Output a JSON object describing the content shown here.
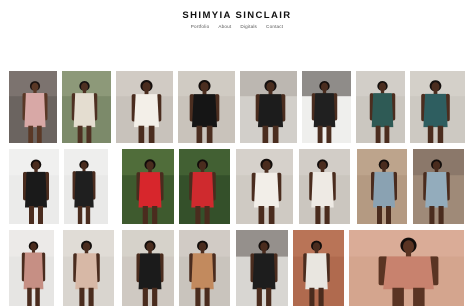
{
  "header": {
    "site_title": "SHIMYIA SINCLAIR",
    "nav": [
      "Portfolio",
      "About",
      "Digitals",
      "Contact"
    ]
  },
  "gallery": {
    "rows": [
      [
        {
          "name": "photo-pink-bra-dark-background",
          "colors": {
            "bg": "#6b6460",
            "top": "#8a807b",
            "skin": "#5a3826",
            "outfit": "#d8a8a6",
            "hair": "#1a1210"
          }
        },
        {
          "name": "photo-white-knit-green-background",
          "colors": {
            "bg": "#7c8a6a",
            "top": "#9aa585",
            "skin": "#4e3022",
            "outfit": "#e4ddd0",
            "hair": "#141010"
          }
        },
        {
          "name": "photo-afro-white-top-grey-background",
          "colors": {
            "bg": "#c8c2bb",
            "top": "#d8d3cc",
            "skin": "#4a2c1e",
            "outfit": "#f3efe8",
            "hair": "#140e0c"
          }
        },
        {
          "name": "photo-black-outfit-grey-background",
          "colors": {
            "bg": "#c9c3bb",
            "top": "#d6d1ca",
            "skin": "#4b2e20",
            "outfit": "#151515",
            "hair": "#120d0b"
          }
        },
        {
          "name": "photo-street-building-white-outfit",
          "colors": {
            "bg": "#d2cfca",
            "top": "#a9a49d",
            "skin": "#4a2d1f",
            "outfit": "#1c1c1c",
            "hair": "#141010"
          }
        },
        {
          "name": "photo-door-frame-black-outfit",
          "colors": {
            "bg": "#efefed",
            "top": "#3f3a36",
            "skin": "#4a2d1f",
            "outfit": "#202020",
            "hair": "#120d0b"
          }
        },
        {
          "name": "photo-green-dress-grey-background",
          "colors": {
            "bg": "#cbc7c0",
            "top": "#d8d4ce",
            "skin": "#4b2d1f",
            "outfit": "#2e5a55",
            "hair": "#140f0d"
          }
        },
        {
          "name": "photo-teal-slip-dress-grey-background",
          "colors": {
            "bg": "#cdc9c2",
            "top": "#dad6d0",
            "skin": "#4b2d1f",
            "outfit": "#2e5e60",
            "hair": "#140f0d"
          }
        }
      ],
      [
        {
          "name": "photo-crouching-white-wall",
          "colors": {
            "bg": "#ebebea",
            "top": "#f4f4f3",
            "skin": "#4a2c1e",
            "outfit": "#1a1a1a",
            "hair": "#110c0a"
          }
        },
        {
          "name": "photo-sitting-white-wall",
          "colors": {
            "bg": "#e9e9e8",
            "top": "#f2f2f1",
            "skin": "#4a2c1e",
            "outfit": "#1f1f1f",
            "hair": "#110c0a"
          }
        },
        {
          "name": "photo-red-dress-park",
          "colors": {
            "bg": "#3e5a2e",
            "top": "#5f7d45",
            "skin": "#4a2c1e",
            "outfit": "#d7262c",
            "hair": "#110c0a"
          }
        },
        {
          "name": "photo-red-dress-trees",
          "colors": {
            "bg": "#34502a",
            "top": "#4e6d3b",
            "skin": "#4a2c1e",
            "outfit": "#cf2a2e",
            "hair": "#110c0a"
          }
        },
        {
          "name": "photo-white-blouse-portrait",
          "colors": {
            "bg": "#cfcac3",
            "top": "#dcd7d1",
            "skin": "#4a2c1e",
            "outfit": "#f2eee8",
            "hair": "#120d0b"
          }
        },
        {
          "name": "photo-white-top-black-pants",
          "colors": {
            "bg": "#cbc6bf",
            "top": "#d9d4ce",
            "skin": "#4a2c1e",
            "outfit": "#eeeae4",
            "hair": "#120d0b"
          }
        },
        {
          "name": "photo-denim-outfit-brick-wall",
          "colors": {
            "bg": "#b49a82",
            "top": "#c5ad96",
            "skin": "#4a2c1e",
            "outfit": "#8aa2b2",
            "hair": "#120d0b"
          }
        },
        {
          "name": "photo-denim-outfit-street",
          "colors": {
            "bg": "#9f8a78",
            "top": "#7a6a5e",
            "skin": "#4a2c1e",
            "outfit": "#93acbc",
            "hair": "#120d0b"
          }
        }
      ],
      [
        {
          "name": "photo-swimsuit-white-wall",
          "colors": {
            "bg": "#e6e5e3",
            "top": "#f0efed",
            "skin": "#4a2c1e",
            "outfit": "#c68f84",
            "hair": "#110c0a"
          }
        },
        {
          "name": "photo-afro-nude-top",
          "colors": {
            "bg": "#d9d5cf",
            "top": "#e5e2dd",
            "skin": "#4a2c1e",
            "outfit": "#d7b8a6",
            "hair": "#140f0d"
          }
        },
        {
          "name": "photo-black-shirt-grey-background",
          "colors": {
            "bg": "#cfc9c2",
            "top": "#ddd8d2",
            "skin": "#4a2c1e",
            "outfit": "#1b1b1b",
            "hair": "#120d0b"
          }
        },
        {
          "name": "photo-tan-bodysuit-grey-background",
          "colors": {
            "bg": "#c9c4bd",
            "top": "#d7d2cc",
            "skin": "#4a2c1e",
            "outfit": "#c28a5e",
            "hair": "#120d0b"
          }
        },
        {
          "name": "photo-rooftop-sitting",
          "colors": {
            "bg": "#d8d6d2",
            "top": "#5e5852",
            "skin": "#4a2c1e",
            "outfit": "#1d1d1d",
            "hair": "#120d0b"
          }
        },
        {
          "name": "photo-sitting-brick-wall",
          "colors": {
            "bg": "#b06a4e",
            "top": "#c17b5e",
            "skin": "#4a2c1e",
            "outfit": "#e9e6e0",
            "hair": "#120d0b"
          }
        },
        {
          "name": "photo-smiling-closeup-peach-background",
          "colors": {
            "bg": "#d4a58e",
            "top": "#deb39e",
            "skin": "#5a3423",
            "outfit": "#c8826e",
            "hair": "#120d0b"
          }
        }
      ]
    ]
  }
}
